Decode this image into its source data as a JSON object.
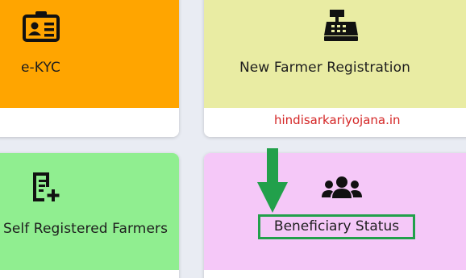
{
  "cards": {
    "ekyc": {
      "label": "e-KYC",
      "icon": "id-card-icon",
      "color": "#FFA500"
    },
    "new_farmer": {
      "label": "New Farmer Registration",
      "icon": "cash-register-icon",
      "color": "#E9ECA3"
    },
    "self_registered": {
      "label": "Self Registered Farmers",
      "icon": "document-add-icon",
      "color": "#90EE90"
    },
    "beneficiary": {
      "label": "Beneficiary Status",
      "icon": "users-icon",
      "color": "#F5C8F8"
    }
  },
  "footer_arrow": "→",
  "watermark": "hindisarkariyojana.in",
  "highlight_color": "#22A04B",
  "annotation_arrow_icon": "down-arrow-icon"
}
